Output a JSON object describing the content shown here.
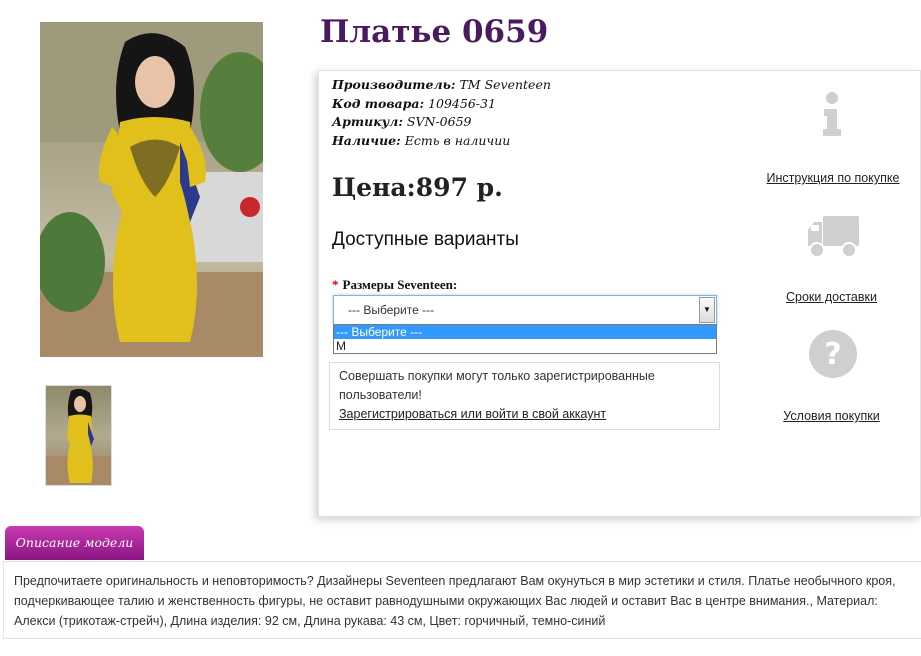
{
  "product": {
    "title": "Платье 0659",
    "manufacturer_label": "Производитель:",
    "manufacturer_value": "ТМ Seventeen",
    "code_label": "Код товара:",
    "code_value": "109456-31",
    "sku_label": "Артикул:",
    "sku_value": "SVN-0659",
    "availability_label": "Наличие:",
    "availability_value": "Есть в наличии",
    "price": "Цена:897 р."
  },
  "options": {
    "title": "Доступные варианты",
    "required_mark": "*",
    "size_label": "Размеры Seventeen:",
    "selected": "--- Выберите ---",
    "items": [
      "--- Выберите ---",
      "M"
    ]
  },
  "notice": {
    "text": "Совершать покупки могут только зарегистрированные пользователи!",
    "link": "Зарегистрироваться или войти в свой аккаунт"
  },
  "sidebar": {
    "instructions_link": "Инструкция по покупке",
    "delivery_link": "Сроки доставки",
    "terms_link": "Условия покупки"
  },
  "description": {
    "tab_label": "Описание модели",
    "text": "Предпочитаете оригинальность и неповторимость? Дизайнеры Seventeen предлагают Вам окунуться в мир эстетики и стиля. Платье необычного кроя, подчеркивающее талию и женственность фигуры, не оставит равнодушными окружающих Вас людей и оставит Вас в центре внимания., Материал: Алекси (трикотаж-стрейч), Длина изделия: 92 см, Длина рукава: 43 см, Цвет: горчичный, темно-синий"
  },
  "colors": {
    "title": "#4a1a5e",
    "tab_top": "#c93bb0",
    "tab_bottom": "#8a1583",
    "dress": "#e2c01c",
    "dress_accent": "#2b3a8c",
    "dropdown_highlight": "#3399ff",
    "required": "#cc0000"
  },
  "icons": [
    "info-icon",
    "truck-icon",
    "question-icon"
  ]
}
